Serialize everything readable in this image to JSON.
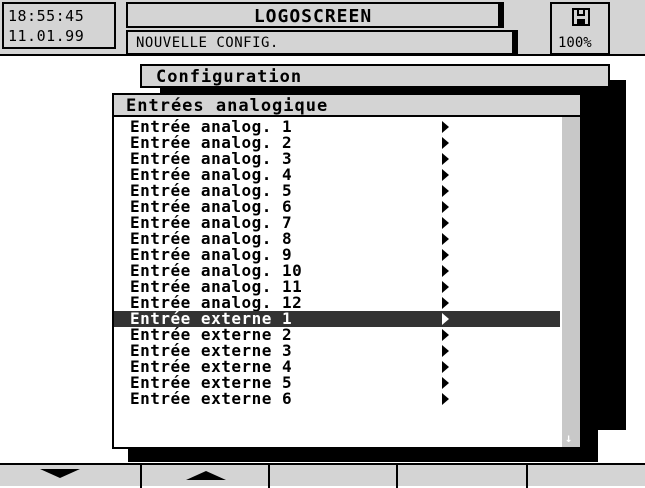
{
  "status": {
    "time": "18:55:45",
    "date": "11.01.99",
    "app_title": "LOGOSCREEN",
    "config_status": "NOUVELLE CONFIG.",
    "save_percent": "100%"
  },
  "menu": {
    "parent_title": "Configuration",
    "title": "Entrées analogique",
    "items": [
      {
        "label": "Entrée analog. 1"
      },
      {
        "label": "Entrée analog. 2"
      },
      {
        "label": "Entrée analog. 3"
      },
      {
        "label": "Entrée analog. 4"
      },
      {
        "label": "Entrée analog. 5"
      },
      {
        "label": "Entrée analog. 6"
      },
      {
        "label": "Entrée analog. 7"
      },
      {
        "label": "Entrée analog. 8"
      },
      {
        "label": "Entrée analog. 9"
      },
      {
        "label": "Entrée analog. 10"
      },
      {
        "label": "Entrée analog. 11"
      },
      {
        "label": "Entrée analog. 12"
      },
      {
        "label": "Entrée externe 1"
      },
      {
        "label": "Entrée externe 2"
      },
      {
        "label": "Entrée externe 3"
      },
      {
        "label": "Entrée externe 4"
      },
      {
        "label": "Entrée externe 5"
      },
      {
        "label": "Entrée externe 6"
      }
    ],
    "selected_index": 12,
    "scroll_down_glyph": "↓"
  },
  "function_keys": [
    {
      "icon": "arrow-down-icon"
    },
    {
      "icon": "arrow-up-icon"
    },
    {
      "icon": ""
    },
    {
      "icon": ""
    },
    {
      "icon": ""
    }
  ],
  "colors": {
    "panel": "#d4d4d4",
    "selection": "#333333",
    "scrollbar": "#c8c8c8"
  }
}
